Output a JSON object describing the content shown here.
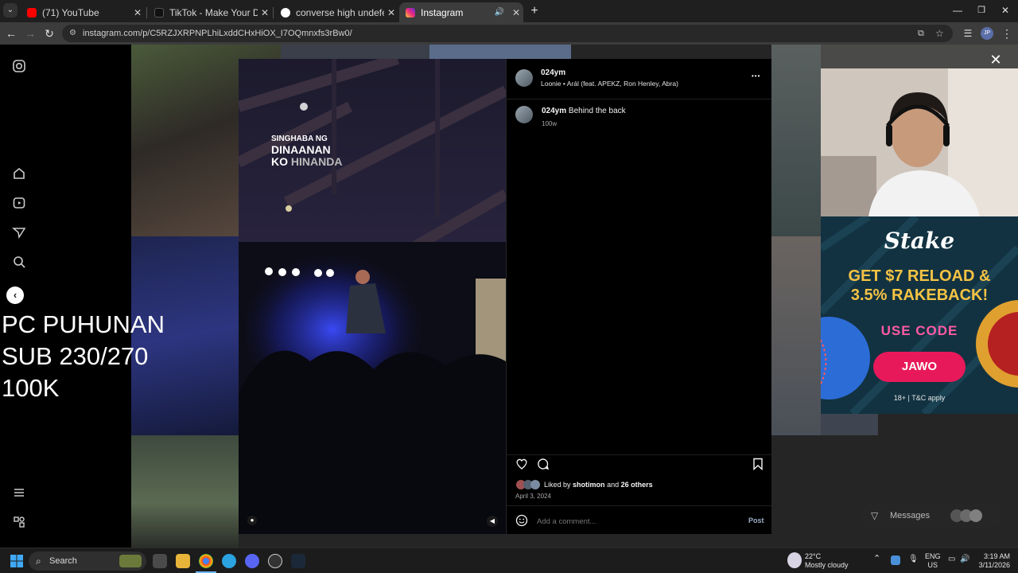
{
  "browser": {
    "tabs": [
      {
        "label": "(71) YouTube",
        "favicon_color": "#ff0000"
      },
      {
        "label": "TikTok - Make Your Day",
        "favicon_color": "#222222"
      },
      {
        "label": "converse high undefeated - Go",
        "favicon_color": "#4285f4"
      },
      {
        "label": "Instagram",
        "favicon_color": "#d6249f",
        "active": true
      }
    ],
    "url": "instagram.com/p/C5RZJXRPNPLhiLxddCHxHiOX_I7OQmnxfs3rBw0/",
    "profile_initials": "JP"
  },
  "stream_overlay": {
    "lines": [
      "PC PUHUNAN",
      "SUB 230/270",
      "100K"
    ]
  },
  "post": {
    "media_text": {
      "line1": "SINGHABA NG",
      "line2": "DINAANAN",
      "line3a": "KO",
      "line3b": "HINANDA"
    },
    "author": "024ym",
    "audio": "Loonie • Arál (feat. APEKZ, Ron Henley, Abra)",
    "caption_user": "024ym",
    "caption_text": "Behind the back",
    "caption_age": "100w",
    "liked_prefix": "Liked by",
    "liked_user": "shotimon",
    "liked_and": "and",
    "liked_others": "26 others",
    "date": "April 3, 2024",
    "comment_placeholder": "Add a comment...",
    "post_label": "Post",
    "more_glyph": "•••"
  },
  "ad": {
    "brand": "Stake",
    "headline1": "GET $7 RELOAD &",
    "headline2": "3.5% RAKEBACK!",
    "use_code": "USE CODE",
    "code": "JAWO",
    "terms": "18+ | T&C apply"
  },
  "messages_label": "Messages",
  "taskbar": {
    "search_label": "Search",
    "weather_temp": "22°C",
    "weather_desc": "Mostly cloudy",
    "lang1": "ENG",
    "lang2": "US",
    "time": "3:19 AM",
    "date": "3/11/2026"
  }
}
